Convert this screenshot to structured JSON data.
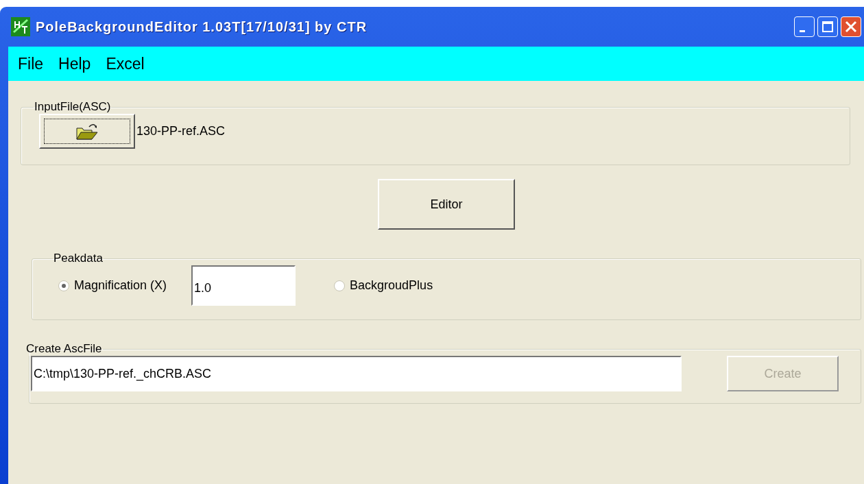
{
  "window": {
    "title": "PoleBackgroundEditor 1.03T[17/10/31] by CTR"
  },
  "menu": [
    "File",
    "Help",
    "Excel"
  ],
  "input_file": {
    "legend": "InputFile(ASC)",
    "file_name": "130-PP-ref.ASC"
  },
  "editor_button": "Editor",
  "peakdata": {
    "legend": "Peakdata",
    "options": [
      {
        "label": "Magnification (X)",
        "selected": true
      },
      {
        "label": "BackgroudPlus",
        "selected": false
      }
    ],
    "magnification": "1.0"
  },
  "create": {
    "legend": "Create AscFile",
    "path": "C:\\tmp\\130-PP-ref._chCRB.ASC",
    "button": {
      "label": "Create",
      "disabled": true
    }
  }
}
